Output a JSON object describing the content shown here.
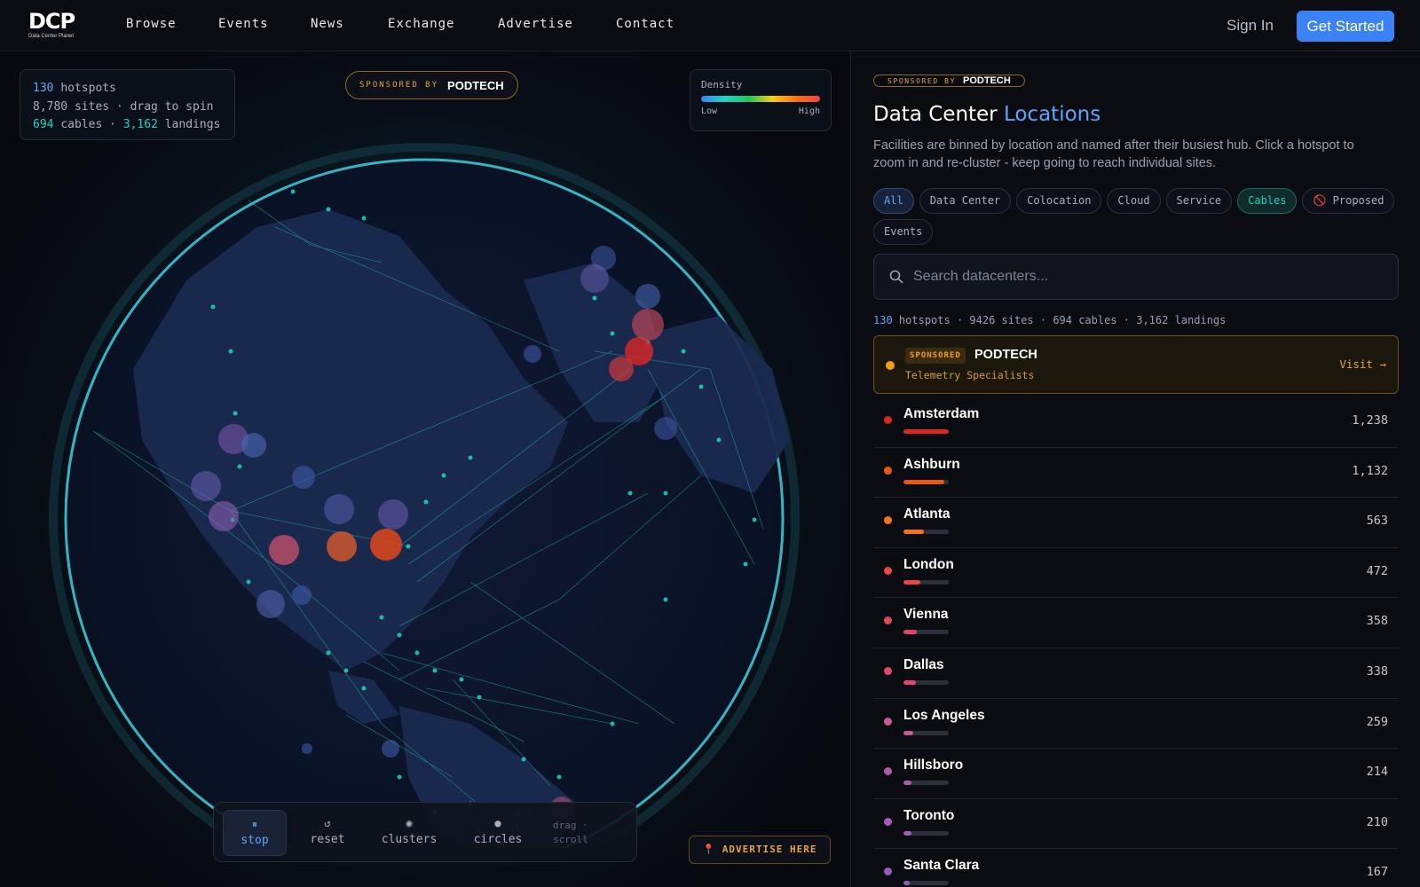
{
  "nav": {
    "logo_text": "DCP",
    "logo_sub": "Data Center Planet",
    "links": [
      "Browse",
      "Events",
      "News",
      "Exchange",
      "Advertise",
      "Contact"
    ],
    "sign_in": "Sign In",
    "get_started": "Get Started"
  },
  "map": {
    "stats": {
      "hotspots_count": "130",
      "hotspots_label": "hotspots",
      "sites_line": "8,780 sites · drag to spin",
      "cables_count": "694",
      "cables_label": "cables ·",
      "landings_count": "3,162",
      "landings_label": "landings"
    },
    "sponsor": {
      "by": "SPONSORED BY",
      "name": "PODTECH"
    },
    "density": {
      "title": "Density",
      "low": "Low",
      "high": "High"
    },
    "controls": {
      "stop": {
        "icon": "⏸",
        "label": "stop"
      },
      "reset": {
        "icon": "↺",
        "label": "reset"
      },
      "clusters": {
        "icon": "◉",
        "label": "clusters"
      },
      "circles": {
        "icon": "●",
        "label": "circles"
      },
      "hint_1": "drag ·",
      "hint_2": "scroll"
    },
    "advertise": "📍 ADVERTISE HERE"
  },
  "panel": {
    "sponsor": {
      "by": "SPONSORED BY",
      "name": "PODTECH"
    },
    "title_main": "Data Center",
    "title_accent": "Locations",
    "description": "Facilities are binned by location and named after their busiest hub. Click a hotspot to zoom in and re-cluster - keep going to reach individual sites.",
    "chips": [
      "All",
      "Data Center",
      "Colocation",
      "Cloud",
      "Service",
      "Cables",
      "🚫 Proposed",
      "Events"
    ],
    "search_placeholder": "Search datacenters...",
    "summary_count": "130",
    "summary_rest": "hotspots · 9426 sites · 694 cables · 3,162 landings",
    "sponsored_item": {
      "badge": "SPONSORED",
      "name": "PODTECH",
      "subtitle": "Telemetry Specialists",
      "visit": "Visit →"
    },
    "locations": [
      {
        "name": "Amsterdam",
        "count": "1,238",
        "level": 1.0,
        "color": "#dc2626"
      },
      {
        "name": "Ashburn",
        "count": "1,132",
        "level": 0.91,
        "color": "#ea580c"
      },
      {
        "name": "Atlanta",
        "count": "563",
        "level": 0.45,
        "color": "#f97316"
      },
      {
        "name": "London",
        "count": "472",
        "level": 0.38,
        "color": "#ef4444"
      },
      {
        "name": "Vienna",
        "count": "358",
        "level": 0.29,
        "color": "#e0465f"
      },
      {
        "name": "Dallas",
        "count": "338",
        "level": 0.27,
        "color": "#e0466b"
      },
      {
        "name": "Los Angeles",
        "count": "259",
        "level": 0.21,
        "color": "#c65a98"
      },
      {
        "name": "Hillsboro",
        "count": "214",
        "level": 0.17,
        "color": "#b05aaa"
      },
      {
        "name": "Toronto",
        "count": "210",
        "level": 0.17,
        "color": "#a35cb3"
      },
      {
        "name": "Santa Clara",
        "count": "167",
        "level": 0.13,
        "color": "#955cb8"
      }
    ]
  }
}
